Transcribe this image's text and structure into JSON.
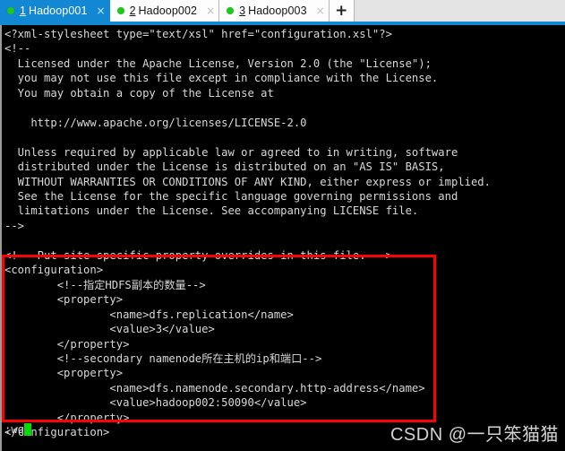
{
  "window": {
    "accent_color": "#1288d4",
    "terminal_bg": "#000000",
    "terminal_fg": "#d8d8d8",
    "highlight_color": "#fe0000",
    "status_dot_color": "#1fc81f",
    "cursor_color": "#00dd00"
  },
  "tabbar": {
    "tabs": [
      {
        "index": "1",
        "label": "Hadoop001",
        "close": "×",
        "active": true,
        "status_icon": "connected-dot"
      },
      {
        "index": "2",
        "label": "Hadoop002",
        "close": "×",
        "active": false,
        "status_icon": "connected-dot"
      },
      {
        "index": "3",
        "label": "Hadoop003",
        "close": "×",
        "active": false,
        "status_icon": "connected-dot"
      }
    ],
    "new_tab_label": "+"
  },
  "terminal": {
    "code_before": "<?xml-stylesheet type=\"text/xsl\" href=\"configuration.xsl\"?>\n<!--\n  Licensed under the Apache License, Version 2.0 (the \"License\");\n  you may not use this file except in compliance with the License.\n  You may obtain a copy of the License at\n\n    http://www.apache.org/licenses/LICENSE-2.0\n\n  Unless required by applicable law or agreed to in writing, software\n  distributed under the License is distributed on an \"AS IS\" BASIS,\n  WITHOUT WARRANTIES OR CONDITIONS OF ANY KIND, either express or implied.\n  See the License for the specific language governing permissions and\n  limitations under the License. See accompanying LICENSE file.\n-->\n\n<!-- Put site-specific property overrides in this file. -->\n",
    "code_highlighted": "<configuration>\n        <!--指定HDFS副本的数量-->\n        <property>\n                <name>dfs.replication</name>\n                <value>3</value>\n        </property>\n        <!--secondary namenode所在主机的ip和端口-->\n        <property>\n                <name>dfs.namenode.secondary.http-address</name>\n                <value>hadoop002:50090</value>\n        </property>\n</configuration>",
    "status_command": ":wq",
    "watermark": "CSDN @一只笨猫猫"
  }
}
